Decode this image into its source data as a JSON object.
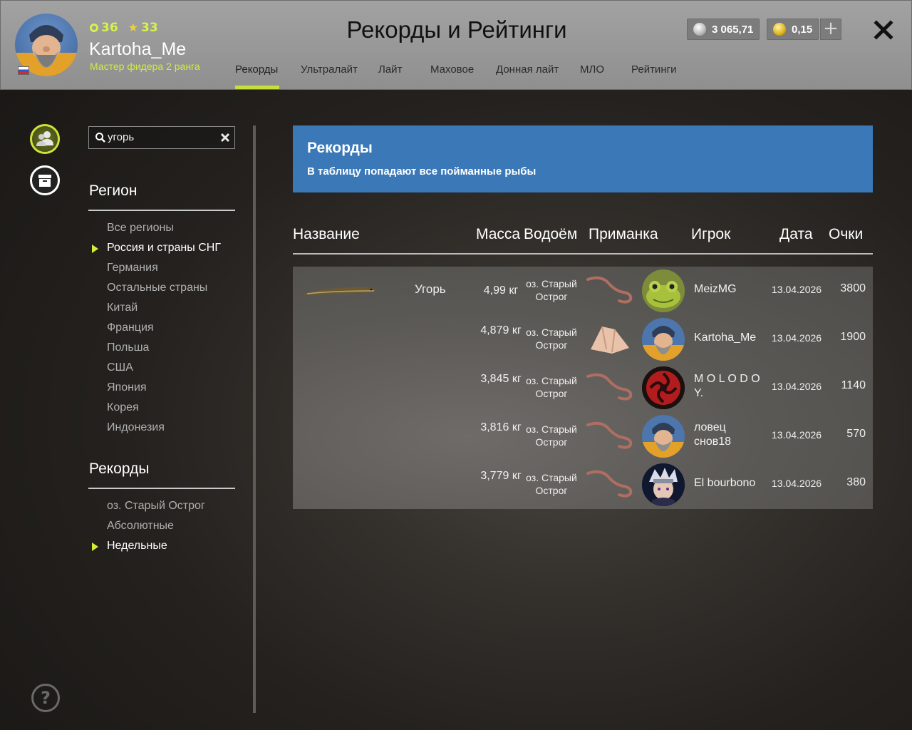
{
  "profile": {
    "level": "36",
    "stars": "33",
    "nickname": "Kartoha_Me",
    "rank": "Мастер фидера 2 ранга"
  },
  "header": {
    "title": "Рекорды и Рейтинги",
    "tabs": [
      "Рекорды",
      "Ультралайт",
      "Лайт",
      "Маховое",
      "Донная лайт",
      "МЛО",
      "Рейтинги"
    ],
    "active_tab": "Рекорды",
    "silver": "3 065,71",
    "gold": "0,15"
  },
  "search": {
    "value": "угорь"
  },
  "region": {
    "title": "Регион",
    "items": [
      "Все регионы",
      "Россия и страны СНГ",
      "Германия",
      "Остальные страны",
      "Китай",
      "Франция",
      "Польша",
      "США",
      "Япония",
      "Корея",
      "Индонезия"
    ],
    "selected": "Россия и страны СНГ"
  },
  "records_nav": {
    "title": "Рекорды",
    "items": [
      "оз. Старый Острог",
      "Абсолютные",
      "Недельные"
    ],
    "selected": "Недельные"
  },
  "banner": {
    "title": "Рекорды",
    "subtitle": "В таблицу попадают все пойманные рыбы"
  },
  "table": {
    "headers": [
      "Название",
      "Масса",
      "Водоём",
      "Приманка",
      "Игрок",
      "Дата",
      "Очки"
    ],
    "fish": "Угорь",
    "rows": [
      {
        "mass": "4,99 кг",
        "lake": "оз. Старый Острог",
        "bait": "worm",
        "player": "MeizMG",
        "avatar": "frog",
        "date": "13.04.2026",
        "score": "3800"
      },
      {
        "mass": "4,879 кг",
        "lake": "оз. Старый Острог",
        "bait": "meat",
        "player": "Kartoha_Me",
        "avatar": "bearded",
        "date": "13.04.2026",
        "score": "1900"
      },
      {
        "mass": "3,845 кг",
        "lake": "оз. Старый Острог",
        "bait": "worm",
        "player": "M O L O D O Y.",
        "avatar": "red-emblem",
        "date": "13.04.2026",
        "score": "1140"
      },
      {
        "mass": "3,816 кг",
        "lake": "оз. Старый Острог",
        "bait": "worm",
        "player": "ловец снов18",
        "avatar": "bearded",
        "date": "13.04.2026",
        "score": "570"
      },
      {
        "mass": "3,779 кг",
        "lake": "оз. Старый Острог",
        "bait": "worm",
        "player": "El bourbono",
        "avatar": "anime",
        "date": "13.04.2026",
        "score": "380"
      }
    ]
  },
  "colors": {
    "accent": "#d7f14b",
    "banner": "#3a78b7",
    "header_bg": "#9a9a9a"
  },
  "icons": [
    "players-icon",
    "archive-icon",
    "help-icon",
    "search-icon",
    "close-icon",
    "plus-icon",
    "silver-coin-icon",
    "gold-coin-icon"
  ]
}
